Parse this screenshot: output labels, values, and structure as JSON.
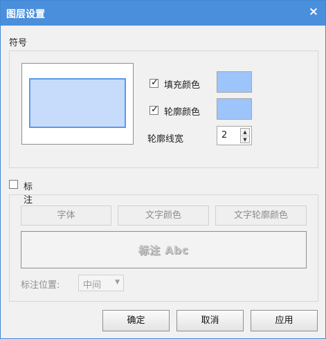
{
  "window": {
    "title": "图层设置",
    "close_glyph": "×"
  },
  "symbol": {
    "section_label": "符号",
    "fill_color": {
      "label": "填充颜色",
      "checked": true,
      "color": "#9ec5fb"
    },
    "outline_color": {
      "label": "轮廓颜色",
      "checked": true,
      "color": "#9ec5fb"
    },
    "outline_width": {
      "label": "轮廓线宽",
      "value": "2"
    },
    "preview": {
      "fill": "#c7dcfb",
      "stroke": "#5a98ea"
    }
  },
  "labeling": {
    "toggle_label": "标注",
    "checked": false,
    "font_button": "字体",
    "text_color_button": "文字颜色",
    "text_outline_color_button": "文字轮廓颜色",
    "sample_text": "标注 Abc",
    "position_label": "标注位置:",
    "position_value": "中间"
  },
  "footer": {
    "ok": "确定",
    "cancel": "取消",
    "apply": "应用"
  },
  "icons": {
    "check": "✓",
    "close": "close-icon",
    "spin_up": "▲",
    "spin_down": "▼",
    "dropdown": "▼"
  }
}
